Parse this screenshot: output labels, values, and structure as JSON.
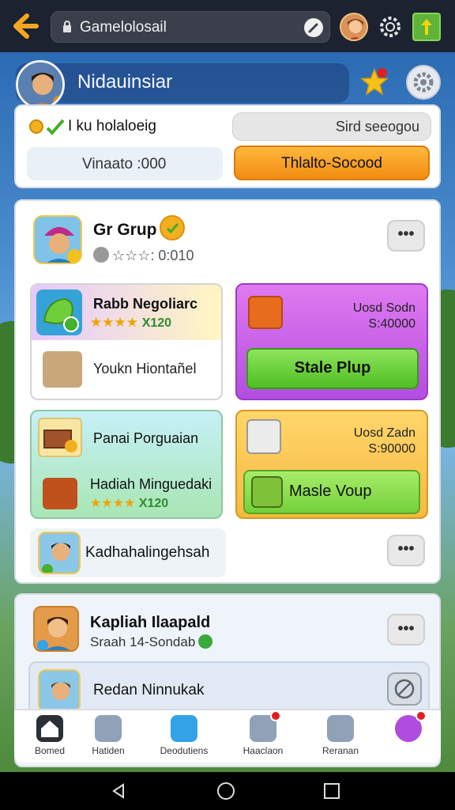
{
  "browser": {
    "url_text": "Gamelolosail"
  },
  "header": {
    "player_name": "Nidauinsiar"
  },
  "top_panel": {
    "title": "I ku holaloeig",
    "pill_text": "Sird seeogou",
    "info_text": "Vinaato :000",
    "action_label": "Thlalto-Socood"
  },
  "group": {
    "title": "Gr Grup",
    "rating_text": "☆☆☆: 0:010",
    "cards": [
      {
        "title": "Rabb Negoliarc",
        "stars": "★★★★",
        "score": "X120",
        "subtitle": "Youkn Hiontañel"
      },
      {
        "label_line1": "Uosd Sodn",
        "label_line2": "S:40000",
        "button_label": "Stale Plup"
      },
      {
        "title": "Panai Porguaian",
        "subtitle": "Hadiah Minguedaki",
        "stars": "★★★★",
        "score": "X120"
      },
      {
        "label_line1": "Uosd Zadn",
        "label_line2": "S:90000",
        "button_label": "Masle Voup"
      }
    ],
    "member_name": "Kadhahalingehsah",
    "more_label": "•••"
  },
  "second_group": {
    "title": "Kapliah Ilaapald",
    "subtitle": "Sraah 14-Sondab",
    "more_label": "•••",
    "row_text": "Redan Ninnukak"
  },
  "bottom_nav": {
    "items": [
      {
        "label": "Bomed",
        "icon": "home-icon",
        "color": "#2b2f36"
      },
      {
        "label": "Hatiden",
        "icon": "box-icon",
        "color": "#8fa2b8"
      },
      {
        "label": "Deodutiens",
        "icon": "cube-icon",
        "color": "#33a3e6"
      },
      {
        "label": "Haaclaon",
        "icon": "photo-icon",
        "color": "#8fa2b8"
      },
      {
        "label": "Reranan",
        "icon": "bag-icon",
        "color": "#8fa2b8"
      },
      {
        "label": "",
        "icon": "ticket-icon",
        "color": "#b04ce0"
      }
    ]
  },
  "colors": {
    "accent_orange": "#f28c12",
    "accent_green": "#4fbf24",
    "accent_purple": "#b24ee0",
    "accent_yellow": "#f6b940"
  }
}
